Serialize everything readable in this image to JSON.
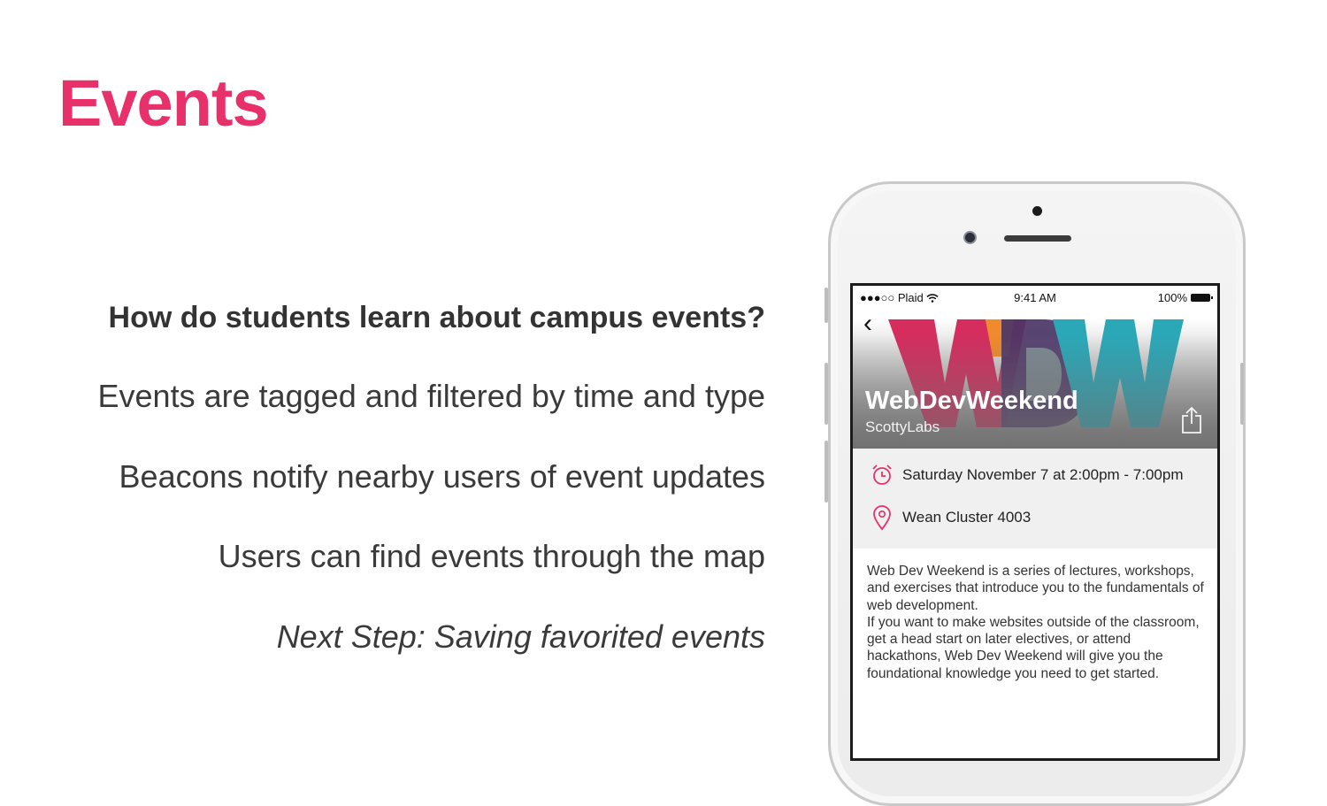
{
  "slide": {
    "title": "Events",
    "bullets": [
      "How do students learn about campus events?",
      "Events are tagged and filtered by time and type",
      "Beacons notify nearby users of event updates",
      "Users can find events through the map",
      "Next Step: Saving favorited events"
    ],
    "accent_color": "#e8306a"
  },
  "phone": {
    "status": {
      "carrier": "●●●○○ Plaid",
      "time": "9:41 AM",
      "battery": "100%"
    },
    "event": {
      "logo_letters": "WDW",
      "title": "WebDevWeekend",
      "organizer": "ScottyLabs",
      "datetime": "Saturday November 7 at 2:00pm - 7:00pm",
      "location": "Wean Cluster 4003",
      "description_1": "Web Dev Weekend is a series of lectures, workshops, and exercises that introduce you to the fundamentals of web development.",
      "description_2": "If you want to make websites outside of the classroom, get a head start on later electives, or attend hackathons, Web Dev Weekend will give you the foundational knowledge you need to get started."
    },
    "icons": {
      "back": "chevron-left-icon",
      "share": "share-icon",
      "clock": "alarm-clock-icon",
      "location": "map-pin-icon",
      "wifi": "wifi-icon"
    }
  }
}
